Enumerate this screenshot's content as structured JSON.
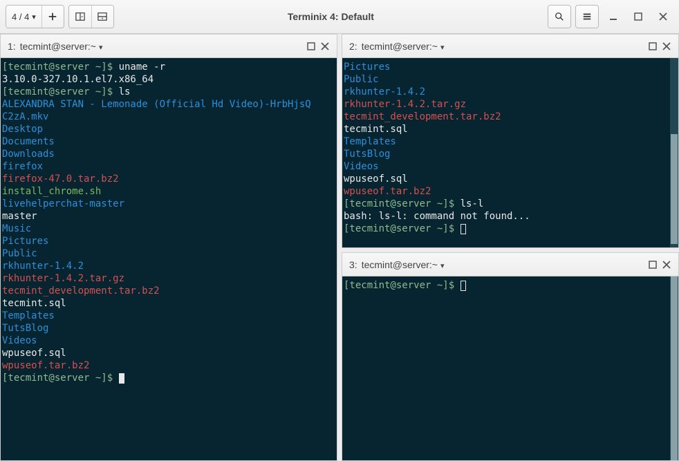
{
  "window": {
    "title": "Terminix 4: Default",
    "session_counter": "4 / 4"
  },
  "panes": {
    "p1": {
      "index": "1:",
      "title": "tecmint@server:~"
    },
    "p2": {
      "index": "2:",
      "title": "tecmint@server:~"
    },
    "p3": {
      "index": "3:",
      "title": "tecmint@server:~"
    }
  },
  "terminal1": {
    "prompt1": "[tecmint@server ~]$ ",
    "cmd1": "uname -r",
    "out1": "3.10.0-327.10.1.el7.x86_64",
    "prompt2": "[tecmint@server ~]$ ",
    "cmd2": "ls",
    "ls": {
      "l1": "ALEXANDRA STAN - Lemonade (Official Hd Video)-HrbHjsQ",
      "l2": "C2zA.mkv",
      "l3": "Desktop",
      "l4": "Documents",
      "l5": "Downloads",
      "l6": "firefox",
      "l7": "firefox-47.0.tar.bz2",
      "l8": "install_chrome.sh",
      "l9": "livehelperchat-master",
      "l10": "master",
      "l11": "Music",
      "l12": "Pictures",
      "l13": "Public",
      "l14": "rkhunter-1.4.2",
      "l15": "rkhunter-1.4.2.tar.gz",
      "l16": "tecmint_development.tar.bz2",
      "l17": "tecmint.sql",
      "l18": "Templates",
      "l19": "TutsBlog",
      "l20": "Videos",
      "l21": "wpuseof.sql",
      "l22": "wpuseof.tar.bz2"
    },
    "prompt3": "[tecmint@server ~]$ "
  },
  "terminal2": {
    "ls": {
      "l1": "Pictures",
      "l2": "Public",
      "l3": "rkhunter-1.4.2",
      "l4": "rkhunter-1.4.2.tar.gz",
      "l5": "tecmint_development.tar.bz2",
      "l6": "tecmint.sql",
      "l7": "Templates",
      "l8": "TutsBlog",
      "l9": "Videos",
      "l10": "wpuseof.sql",
      "l11": "wpuseof.tar.bz2"
    },
    "prompt1": "[tecmint@server ~]$ ",
    "cmd1": "ls-l",
    "err1": "bash: ls-l: command not found...",
    "prompt2": "[tecmint@server ~]$ "
  },
  "terminal3": {
    "prompt1": "[tecmint@server ~]$ "
  }
}
